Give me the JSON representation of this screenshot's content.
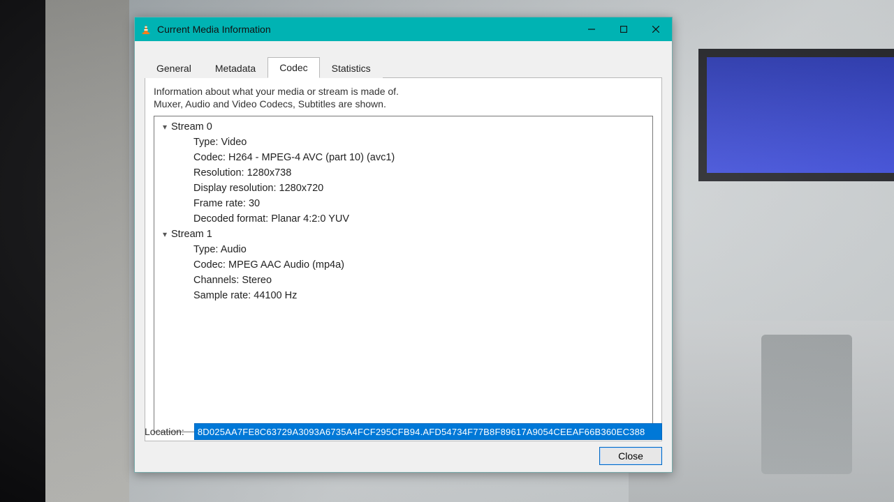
{
  "window": {
    "title": "Current Media Information",
    "tabs": {
      "general": "General",
      "metadata": "Metadata",
      "codec": "Codec",
      "statistics": "Statistics"
    }
  },
  "codecPage": {
    "descLine1": "Information about what your media or stream is made of.",
    "descLine2": "Muxer, Audio and Video Codecs, Subtitles are shown.",
    "streams": [
      {
        "header": "Stream 0",
        "rows": [
          {
            "k": "Type",
            "v": "Video"
          },
          {
            "k": "Codec",
            "v": "H264 - MPEG-4 AVC (part 10) (avc1)"
          },
          {
            "k": "Resolution",
            "v": "1280x738"
          },
          {
            "k": "Display resolution",
            "v": "1280x720"
          },
          {
            "k": "Frame rate",
            "v": "30"
          },
          {
            "k": "Decoded format",
            "v": "Planar 4:2:0 YUV"
          }
        ]
      },
      {
        "header": "Stream 1",
        "rows": [
          {
            "k": "Type",
            "v": "Audio"
          },
          {
            "k": "Codec",
            "v": "MPEG AAC Audio (mp4a)"
          },
          {
            "k": "Channels",
            "v": "Stereo"
          },
          {
            "k": "Sample rate",
            "v": "44100 Hz"
          }
        ]
      }
    ]
  },
  "footer": {
    "locationLabel": "Location:",
    "locationValue": "8D025AA7FE8C63729A3093A6735A4FCF295CFB94.AFD54734F77B8F89617A9054CEEAF66B360EC388",
    "closeLabel": "Close"
  }
}
